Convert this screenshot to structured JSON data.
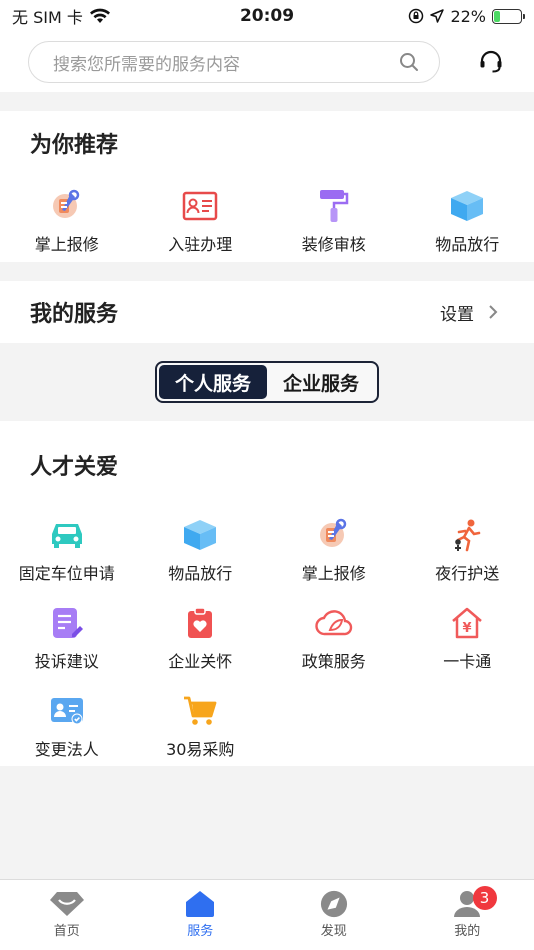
{
  "status_bar": {
    "carrier": "无 SIM 卡",
    "time": "20:09",
    "battery": "22%",
    "battery_level": 0.22
  },
  "search": {
    "placeholder": "搜索您所需要的服务内容"
  },
  "recommend": {
    "title": "为你推荐",
    "items": [
      {
        "label": "掌上报修",
        "icon": "repair-icon"
      },
      {
        "label": "入驻办理",
        "icon": "id-card-icon"
      },
      {
        "label": "装修审核",
        "icon": "paint-roller-icon"
      },
      {
        "label": "物品放行",
        "icon": "box-icon"
      }
    ]
  },
  "my_service": {
    "title": "我的服务",
    "settings_label": "设置"
  },
  "service_toggle": {
    "personal": "个人服务",
    "enterprise": "企业服务",
    "selected": "personal"
  },
  "talent_care": {
    "title": "人才关爱",
    "items": [
      {
        "label": "固定车位申请",
        "icon": "car-icon"
      },
      {
        "label": "物品放行",
        "icon": "box-icon"
      },
      {
        "label": "掌上报修",
        "icon": "repair-icon"
      },
      {
        "label": "夜行护送",
        "icon": "walking-icon"
      },
      {
        "label": "投诉建议",
        "icon": "document-edit-icon"
      },
      {
        "label": "企业关怀",
        "icon": "care-heart-icon"
      },
      {
        "label": "政策服务",
        "icon": "cloud-leaf-icon"
      },
      {
        "label": "一卡通",
        "icon": "house-yen-icon"
      },
      {
        "label": "变更法人",
        "icon": "id-badge-check-icon"
      },
      {
        "label": "30易采购",
        "icon": "shopping-cart-icon"
      }
    ]
  },
  "tab_bar": {
    "items": [
      {
        "label": "首页",
        "icon": "diamond-icon"
      },
      {
        "label": "服务",
        "icon": "home-icon",
        "active": true
      },
      {
        "label": "发现",
        "icon": "compass-icon"
      },
      {
        "label": "我的",
        "icon": "user-icon",
        "badge": "3"
      }
    ]
  },
  "colors": {
    "accent": "#2f6ff0",
    "toggle_active": "#16213a",
    "badge": "#f0383e"
  }
}
